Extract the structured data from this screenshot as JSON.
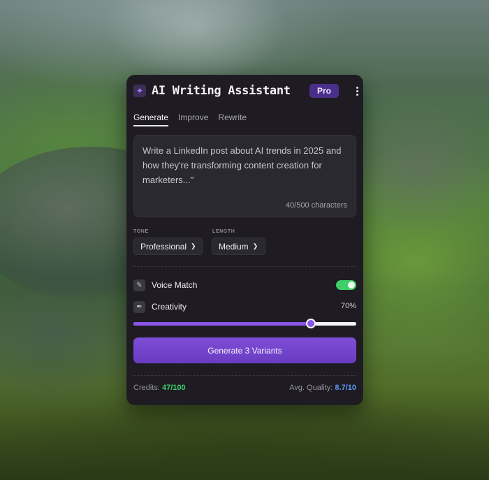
{
  "header": {
    "title": "AI Writing Assistant",
    "badge": "Pro"
  },
  "tabs": [
    {
      "label": "Generate",
      "active": true
    },
    {
      "label": "Improve",
      "active": false
    },
    {
      "label": "Rewrite",
      "active": false
    }
  ],
  "prompt": {
    "text": "Write a LinkedIn post about AI trends in 2025 and how they're transforming content creation for marketers...\"",
    "char_count": "40/500 characters"
  },
  "tone": {
    "label": "TONE",
    "value": "Professional"
  },
  "length": {
    "label": "LENGTH",
    "value": "Medium"
  },
  "voice_match": {
    "label": "Voice Match",
    "enabled": true
  },
  "creativity": {
    "label": "Creativity",
    "value_text": "70%",
    "value": 0.795
  },
  "generate_button": {
    "label": "Generate 3 Variants"
  },
  "footer": {
    "credits_label": "Credits:",
    "credits_value": "47/100",
    "quality_label": "Avg. Quality:",
    "quality_value": "8.7/10"
  },
  "colors": {
    "accent": "#8b55e8",
    "toggle_on": "#3fcf6a",
    "credits": "#3fcf6a",
    "quality": "#5b93f0",
    "panel_bg": "#1e1c22"
  },
  "icons": {
    "app": "sparkle-icon",
    "menu": "kebab-menu-icon",
    "voice_match": "edit-square-icon",
    "creativity": "pen-tool-icon",
    "dropdown": "chevron-down-icon"
  }
}
